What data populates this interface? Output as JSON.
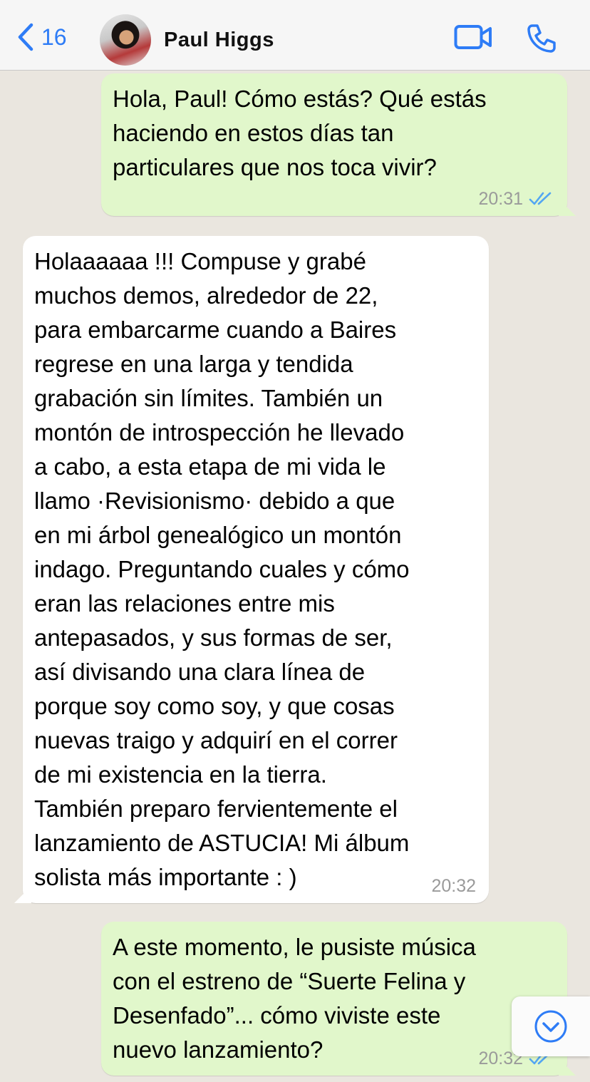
{
  "header": {
    "back_count": "16",
    "contact_name": "Paul  Higgs",
    "accent_color": "#2e7cf6",
    "icons": [
      "chevron-left-icon",
      "video-camera-icon",
      "phone-icon"
    ]
  },
  "messages": [
    {
      "direction": "outgoing",
      "text": "Hola, Paul! Cómo estás? Qué estás\nhaciendo en estos días tan\nparticulares que nos toca vivir?",
      "time": "20:31",
      "status": "read"
    },
    {
      "direction": "incoming",
      "text": "Holaaaaaa !!! Compuse y grabé\nmuchos demos, alrededor de 22,\npara embarcarme cuando a Baires\nregrese en una larga y tendida\ngrabación sin límites.  También un\nmontón de introspección he llevado\na cabo, a esta etapa de mi vida le\nllamo ·Revisionismo· debido a que\nen mi árbol genealógico un montón\nindago. Preguntando cuales y cómo\neran las relaciones entre mis\nantepasados, y sus formas de ser,\nasí divisando una clara línea de\nporque soy como soy, y que cosas\nnuevas traigo y adquirí en el correr\nde mi existencia en la tierra.\nTambién preparo fervientemente el\nlanzamiento de ASTUCIA! Mi álbum\nsolista más importante : )",
      "time": "20:32"
    },
    {
      "direction": "outgoing",
      "text": "A este momento, le pusiste música\ncon el estreno de “Suerte Felina y\nDesenfado”... cómo viviste este\nnuevo lanzamiento?",
      "time": "20:32",
      "status": "read"
    }
  ],
  "colors": {
    "outgoing_bubble": "#e1f7cb",
    "incoming_bubble": "#ffffff",
    "chat_background": "#eae6df",
    "read_ticks": "#53a6f2"
  }
}
